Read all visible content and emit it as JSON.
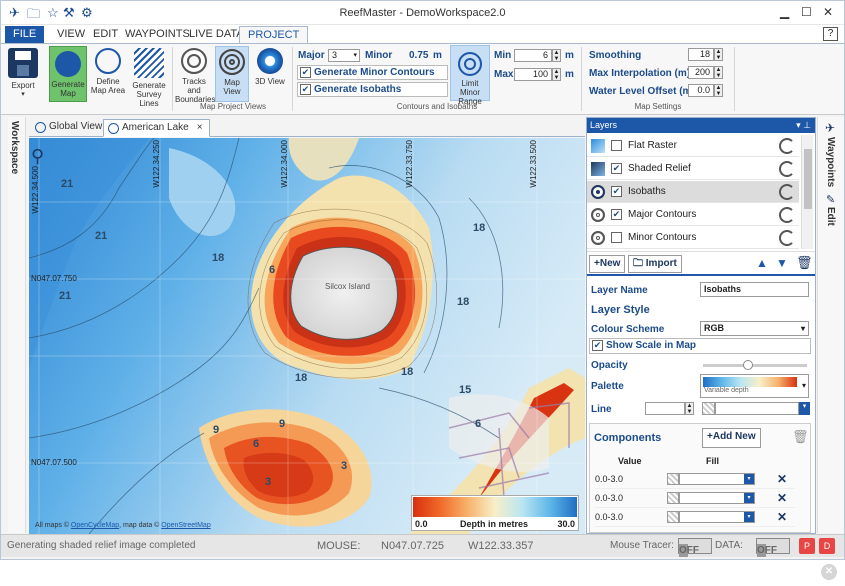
{
  "window": {
    "title": "ReefMaster - DemoWorkspace2.0"
  },
  "menu": {
    "file": "FILE",
    "items": [
      "VIEW",
      "EDIT",
      "WAYPOINTS",
      "LIVE DATA",
      "PROJECT"
    ],
    "help": "?"
  },
  "ribbon": {
    "buttons": {
      "export": "Export",
      "generate_map": "Generate Map",
      "define_map_area": "Define Map Area",
      "generate_survey_lines": "Generate Survey Lines",
      "tracks_and_boundaries": "Tracks and Boundaries",
      "map_view": "Map View",
      "view_3d": "3D View",
      "limit_minor_range": "Limit Minor Range"
    },
    "groups": {
      "map_project_views": "Map Project Views",
      "contours_and_isobaths": "Contours and Isobaths",
      "map_settings": "Map Settings"
    },
    "contours": {
      "major_label": "Major",
      "major_value": "3",
      "minor_label": "Minor",
      "minor_value": "0.75",
      "minor_unit": "m",
      "generate_minor": "Generate Minor Contours",
      "generate_isobaths": "Generate Isobaths"
    },
    "range": {
      "min_label": "Min",
      "min_value": "6",
      "min_unit": "m",
      "max_label": "Max",
      "max_value": "100",
      "max_unit": "m"
    },
    "settings": {
      "smoothing_label": "Smoothing",
      "smoothing_value": "18",
      "max_interp_label": "Max Interpolation (m)",
      "max_interp_value": "200",
      "water_offset_label": "Water Level Offset (m)",
      "water_offset_value": "0.0"
    }
  },
  "workspace": {
    "label": "Workspace"
  },
  "tabs": {
    "global_view": "Global View",
    "american_lake": "American Lake",
    "close": "×"
  },
  "map": {
    "grid_labels": {
      "w1": "W122.34.500",
      "w2": "W122.34.250",
      "w3": "W122.34.000",
      "w4": "W122.33.750",
      "w5": "W122.33.500",
      "n1": "N047.07.750",
      "n2": "N047.07.500"
    },
    "depth_labels": [
      "21",
      "21",
      "21",
      "18",
      "18",
      "18",
      "18",
      "6",
      "15",
      "18",
      "6",
      "9",
      "6",
      "9",
      "3",
      "3"
    ],
    "island": "Silcox Island",
    "attribution": {
      "prefix": "All maps ©",
      "open_cycle_map": "OpenCycleMap",
      "middle": ", map data ©",
      "open_street_map": "OpenStreetMap"
    },
    "legend": {
      "min": "0.0",
      "title": "Depth in metres",
      "max": "30.0"
    }
  },
  "layers": {
    "title": "Layers",
    "items": [
      {
        "name": "Flat Raster",
        "checked": false
      },
      {
        "name": "Shaded Relief",
        "checked": true
      },
      {
        "name": "Isobaths",
        "checked": true
      },
      {
        "name": "Major Contours",
        "checked": true
      },
      {
        "name": "Minor Contours",
        "checked": false
      }
    ],
    "new_label": "New",
    "import_label": "Import"
  },
  "properties": {
    "layer_name_label": "Layer Name",
    "layer_name_value": "Isobaths",
    "layer_style_label": "Layer Style",
    "colour_scheme_label": "Colour Scheme",
    "colour_scheme_value": "RGB",
    "show_scale_label": "Show Scale in Map",
    "opacity_label": "Opacity",
    "palette_label": "Palette",
    "palette_value": "Variable depth",
    "line_label": "Line",
    "components_label": "Components",
    "add_new_label": "Add New",
    "value_header": "Value",
    "fill_header": "Fill",
    "components": [
      "0.0-3.0",
      "0.0-3.0",
      "0.0-3.0"
    ]
  },
  "right_strip": {
    "waypoints": "Waypoints",
    "edit": "Edit"
  },
  "status": {
    "message": "Generating shaded relief image completed",
    "mouse_label": "MOUSE:",
    "lat": "N047.07.725",
    "lon": "W122.33.357",
    "tracer_label": "Mouse Tracer:",
    "tracer_state": "OFF",
    "data_label": "DATA:",
    "data_state": "OFF"
  },
  "colors": {
    "accent": "#1c57a8",
    "deep_water": "#3d8fd6",
    "shallow": "#e84020"
  }
}
